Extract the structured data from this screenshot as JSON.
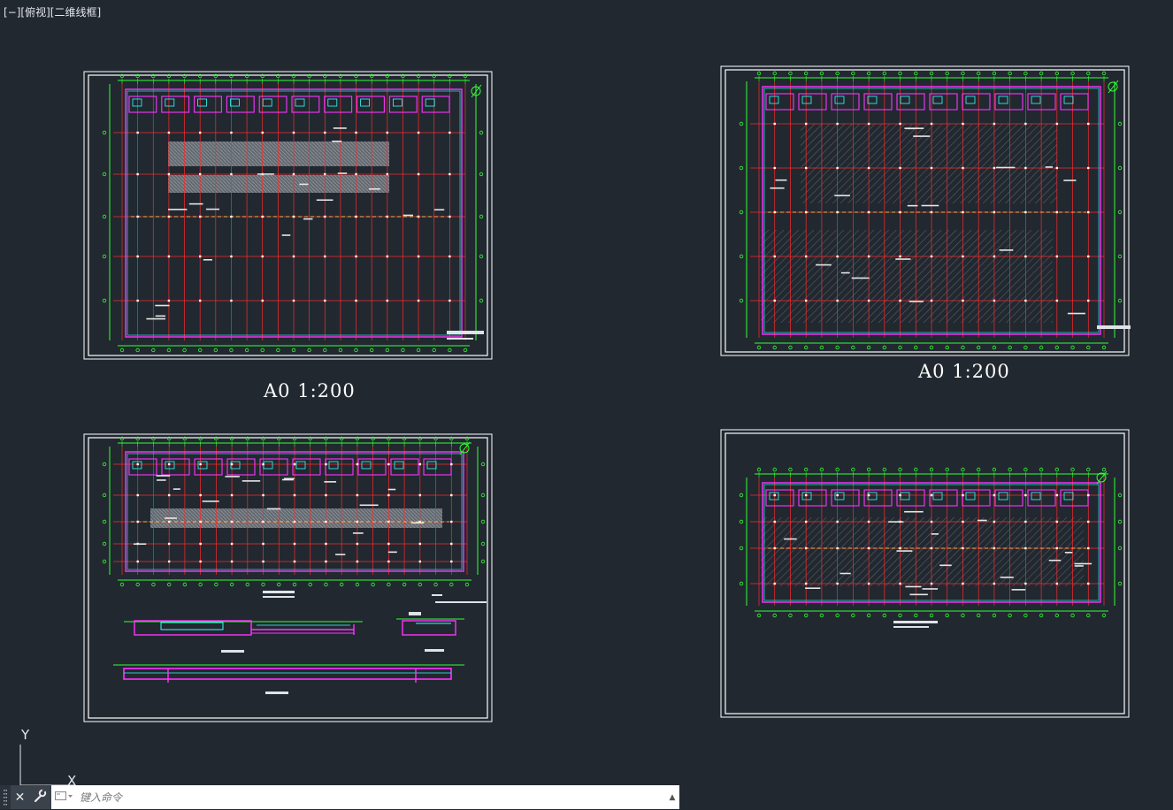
{
  "viewport": {
    "minus_label": "[−]",
    "view_label": "[俯视]",
    "style_label": "[二维线框]"
  },
  "sheets": [
    {
      "scale_label": "A0   1:200"
    },
    {
      "scale_label": "A0   1:200"
    }
  ],
  "ucs": {
    "y_label": "Y",
    "x_label": "X"
  },
  "command": {
    "placeholder": "键入命令",
    "close_glyph": "✕",
    "settings_glyph": "🔧",
    "up_glyph": "▲"
  },
  "colors": {
    "background": "#212830",
    "grid_red": "#ff2a2a",
    "axis_green": "#33ff33",
    "wall_magenta": "#ff33ff",
    "detail_cyan": "#33ffff",
    "hatch_gray": "#8a8f96",
    "frame_white": "#ffffff"
  }
}
